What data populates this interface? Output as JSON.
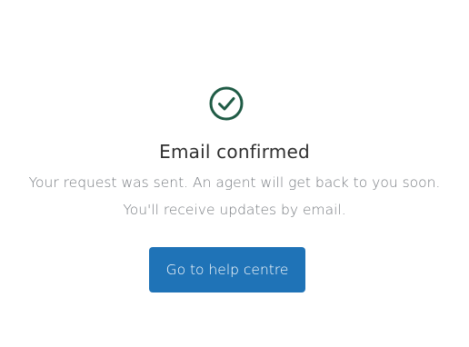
{
  "confirmation": {
    "icon": "check-circle-icon",
    "title": "Email confirmed",
    "message_line1": "Your request was sent. An agent will get back to you soon.",
    "message_line2": "You'll receive updates by email.",
    "button_label": "Go to help centre"
  },
  "colors": {
    "accent": "#1f73b7",
    "success": "#1f5b45",
    "title_text": "#2f2f2f",
    "muted_text": "#777b80"
  }
}
